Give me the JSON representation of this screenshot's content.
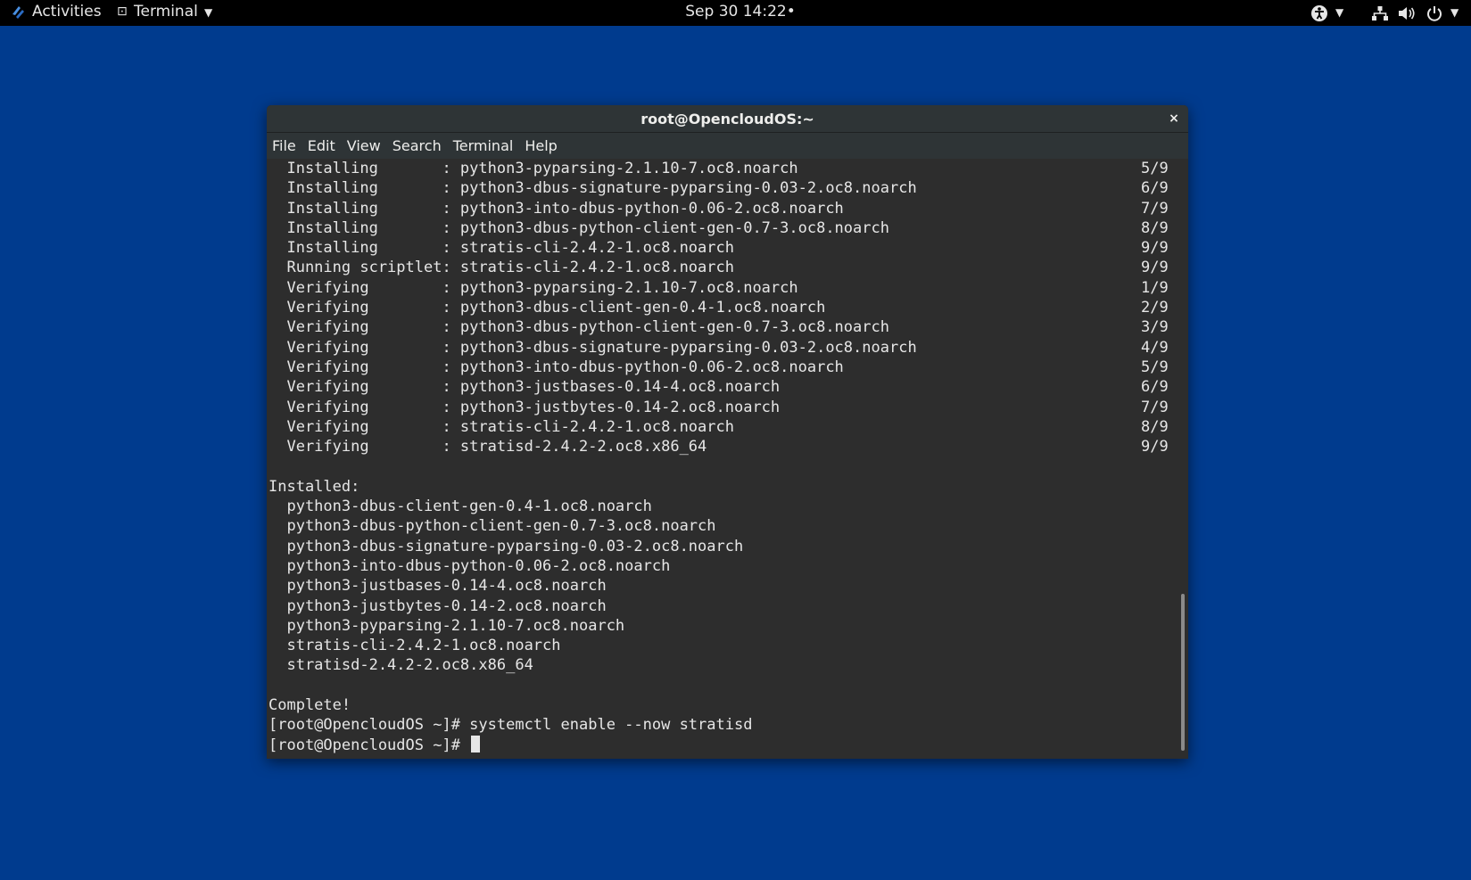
{
  "topbar": {
    "activities": "Activities",
    "app_icon": "⊡",
    "app_label": "Terminal",
    "app_caret": "▼",
    "clock": "Sep 30  14:22•",
    "icons": [
      "accessibility-icon",
      "network-icon",
      "volume-icon",
      "power-icon"
    ]
  },
  "window": {
    "title": "root@OpencloudOS:~",
    "close": "×",
    "menu": [
      "File",
      "Edit",
      "View",
      "Search",
      "Terminal",
      "Help"
    ]
  },
  "terminal": {
    "progress": [
      {
        "text": "  Installing       : python3-pyparsing-2.1.10-7.oc8.noarch",
        "count": "5/9"
      },
      {
        "text": "  Installing       : python3-dbus-signature-pyparsing-0.03-2.oc8.noarch",
        "count": "6/9"
      },
      {
        "text": "  Installing       : python3-into-dbus-python-0.06-2.oc8.noarch",
        "count": "7/9"
      },
      {
        "text": "  Installing       : python3-dbus-python-client-gen-0.7-3.oc8.noarch",
        "count": "8/9"
      },
      {
        "text": "  Installing       : stratis-cli-2.4.2-1.oc8.noarch",
        "count": "9/9"
      },
      {
        "text": "  Running scriptlet: stratis-cli-2.4.2-1.oc8.noarch",
        "count": "9/9"
      },
      {
        "text": "  Verifying        : python3-pyparsing-2.1.10-7.oc8.noarch",
        "count": "1/9"
      },
      {
        "text": "  Verifying        : python3-dbus-client-gen-0.4-1.oc8.noarch",
        "count": "2/9"
      },
      {
        "text": "  Verifying        : python3-dbus-python-client-gen-0.7-3.oc8.noarch",
        "count": "3/9"
      },
      {
        "text": "  Verifying        : python3-dbus-signature-pyparsing-0.03-2.oc8.noarch",
        "count": "4/9"
      },
      {
        "text": "  Verifying        : python3-into-dbus-python-0.06-2.oc8.noarch",
        "count": "5/9"
      },
      {
        "text": "  Verifying        : python3-justbases-0.14-4.oc8.noarch",
        "count": "6/9"
      },
      {
        "text": "  Verifying        : python3-justbytes-0.14-2.oc8.noarch",
        "count": "7/9"
      },
      {
        "text": "  Verifying        : stratis-cli-2.4.2-1.oc8.noarch",
        "count": "8/9"
      },
      {
        "text": "  Verifying        : stratisd-2.4.2-2.oc8.x86_64",
        "count": "9/9"
      }
    ],
    "installed_header": "Installed:",
    "installed": [
      "  python3-dbus-client-gen-0.4-1.oc8.noarch",
      "  python3-dbus-python-client-gen-0.7-3.oc8.noarch",
      "  python3-dbus-signature-pyparsing-0.03-2.oc8.noarch",
      "  python3-into-dbus-python-0.06-2.oc8.noarch",
      "  python3-justbases-0.14-4.oc8.noarch",
      "  python3-justbytes-0.14-2.oc8.noarch",
      "  python3-pyparsing-2.1.10-7.oc8.noarch",
      "  stratis-cli-2.4.2-1.oc8.noarch",
      "  stratisd-2.4.2-2.oc8.x86_64"
    ],
    "complete": "Complete!",
    "command_line": "[root@OpencloudOS ~]# systemctl enable --now stratisd",
    "prompt": "[root@OpencloudOS ~]# "
  }
}
